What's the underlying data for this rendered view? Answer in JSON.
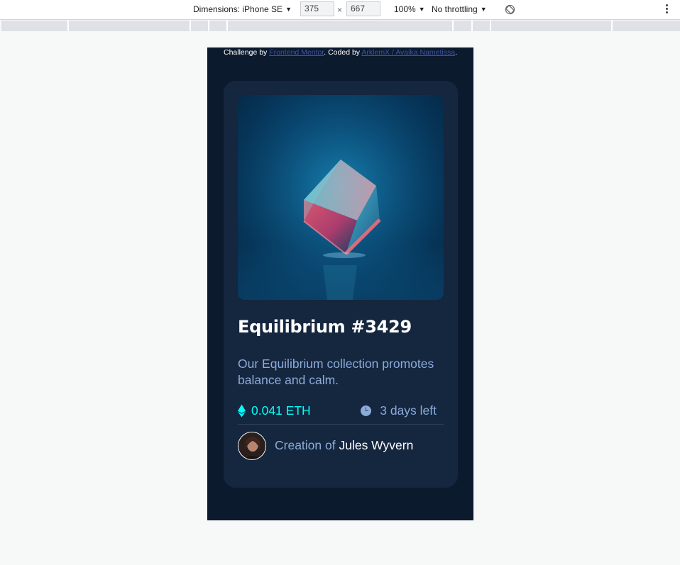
{
  "devtools": {
    "dimensions_label": "Dimensions: iPhone SE",
    "width_value": "375",
    "height_value": "667",
    "times_sign": "×",
    "zoom": "100%",
    "throttling": "No throttling"
  },
  "page": {
    "attribution": {
      "challenge_prefix": "Challenge by ",
      "challenge_link": "Frontend Mentor",
      "coded_prefix": ". Coded by ",
      "coded_link": "ArklemX / Avaika Nametissa",
      "suffix": "."
    },
    "card": {
      "title": "Equilibrium #3429",
      "description": "Our Equilibrium collection promotes balance and calm.",
      "price": "0.041 ETH",
      "time_left": "3 days left",
      "creator_prefix": "Creation of ",
      "creator_name": "Jules Wyvern"
    }
  },
  "colors": {
    "page_bg": "#0c1a2e",
    "card_bg": "#15263f",
    "cyan": "#00fff8",
    "soft_blue": "#8bacd9",
    "white": "#ffffff",
    "divider": "#2e405a"
  },
  "icons": {
    "eth": "ethereum-icon",
    "clock": "clock-icon",
    "rotate": "rotate-icon",
    "more": "more-vertical-icon"
  }
}
